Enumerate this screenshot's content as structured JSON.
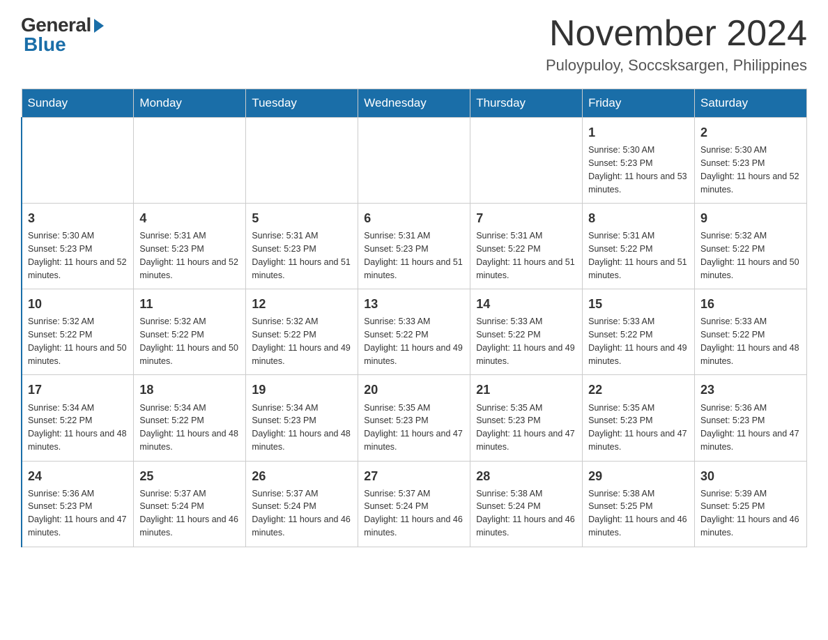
{
  "logo": {
    "general": "General",
    "blue": "Blue"
  },
  "header": {
    "month": "November 2024",
    "location": "Puloypuloy, Soccsksargen, Philippines"
  },
  "weekdays": [
    "Sunday",
    "Monday",
    "Tuesday",
    "Wednesday",
    "Thursday",
    "Friday",
    "Saturday"
  ],
  "weeks": [
    [
      {
        "day": "",
        "sunrise": "",
        "sunset": "",
        "daylight": ""
      },
      {
        "day": "",
        "sunrise": "",
        "sunset": "",
        "daylight": ""
      },
      {
        "day": "",
        "sunrise": "",
        "sunset": "",
        "daylight": ""
      },
      {
        "day": "",
        "sunrise": "",
        "sunset": "",
        "daylight": ""
      },
      {
        "day": "",
        "sunrise": "",
        "sunset": "",
        "daylight": ""
      },
      {
        "day": "1",
        "sunrise": "Sunrise: 5:30 AM",
        "sunset": "Sunset: 5:23 PM",
        "daylight": "Daylight: 11 hours and 53 minutes."
      },
      {
        "day": "2",
        "sunrise": "Sunrise: 5:30 AM",
        "sunset": "Sunset: 5:23 PM",
        "daylight": "Daylight: 11 hours and 52 minutes."
      }
    ],
    [
      {
        "day": "3",
        "sunrise": "Sunrise: 5:30 AM",
        "sunset": "Sunset: 5:23 PM",
        "daylight": "Daylight: 11 hours and 52 minutes."
      },
      {
        "day": "4",
        "sunrise": "Sunrise: 5:31 AM",
        "sunset": "Sunset: 5:23 PM",
        "daylight": "Daylight: 11 hours and 52 minutes."
      },
      {
        "day": "5",
        "sunrise": "Sunrise: 5:31 AM",
        "sunset": "Sunset: 5:23 PM",
        "daylight": "Daylight: 11 hours and 51 minutes."
      },
      {
        "day": "6",
        "sunrise": "Sunrise: 5:31 AM",
        "sunset": "Sunset: 5:23 PM",
        "daylight": "Daylight: 11 hours and 51 minutes."
      },
      {
        "day": "7",
        "sunrise": "Sunrise: 5:31 AM",
        "sunset": "Sunset: 5:22 PM",
        "daylight": "Daylight: 11 hours and 51 minutes."
      },
      {
        "day": "8",
        "sunrise": "Sunrise: 5:31 AM",
        "sunset": "Sunset: 5:22 PM",
        "daylight": "Daylight: 11 hours and 51 minutes."
      },
      {
        "day": "9",
        "sunrise": "Sunrise: 5:32 AM",
        "sunset": "Sunset: 5:22 PM",
        "daylight": "Daylight: 11 hours and 50 minutes."
      }
    ],
    [
      {
        "day": "10",
        "sunrise": "Sunrise: 5:32 AM",
        "sunset": "Sunset: 5:22 PM",
        "daylight": "Daylight: 11 hours and 50 minutes."
      },
      {
        "day": "11",
        "sunrise": "Sunrise: 5:32 AM",
        "sunset": "Sunset: 5:22 PM",
        "daylight": "Daylight: 11 hours and 50 minutes."
      },
      {
        "day": "12",
        "sunrise": "Sunrise: 5:32 AM",
        "sunset": "Sunset: 5:22 PM",
        "daylight": "Daylight: 11 hours and 49 minutes."
      },
      {
        "day": "13",
        "sunrise": "Sunrise: 5:33 AM",
        "sunset": "Sunset: 5:22 PM",
        "daylight": "Daylight: 11 hours and 49 minutes."
      },
      {
        "day": "14",
        "sunrise": "Sunrise: 5:33 AM",
        "sunset": "Sunset: 5:22 PM",
        "daylight": "Daylight: 11 hours and 49 minutes."
      },
      {
        "day": "15",
        "sunrise": "Sunrise: 5:33 AM",
        "sunset": "Sunset: 5:22 PM",
        "daylight": "Daylight: 11 hours and 49 minutes."
      },
      {
        "day": "16",
        "sunrise": "Sunrise: 5:33 AM",
        "sunset": "Sunset: 5:22 PM",
        "daylight": "Daylight: 11 hours and 48 minutes."
      }
    ],
    [
      {
        "day": "17",
        "sunrise": "Sunrise: 5:34 AM",
        "sunset": "Sunset: 5:22 PM",
        "daylight": "Daylight: 11 hours and 48 minutes."
      },
      {
        "day": "18",
        "sunrise": "Sunrise: 5:34 AM",
        "sunset": "Sunset: 5:22 PM",
        "daylight": "Daylight: 11 hours and 48 minutes."
      },
      {
        "day": "19",
        "sunrise": "Sunrise: 5:34 AM",
        "sunset": "Sunset: 5:23 PM",
        "daylight": "Daylight: 11 hours and 48 minutes."
      },
      {
        "day": "20",
        "sunrise": "Sunrise: 5:35 AM",
        "sunset": "Sunset: 5:23 PM",
        "daylight": "Daylight: 11 hours and 47 minutes."
      },
      {
        "day": "21",
        "sunrise": "Sunrise: 5:35 AM",
        "sunset": "Sunset: 5:23 PM",
        "daylight": "Daylight: 11 hours and 47 minutes."
      },
      {
        "day": "22",
        "sunrise": "Sunrise: 5:35 AM",
        "sunset": "Sunset: 5:23 PM",
        "daylight": "Daylight: 11 hours and 47 minutes."
      },
      {
        "day": "23",
        "sunrise": "Sunrise: 5:36 AM",
        "sunset": "Sunset: 5:23 PM",
        "daylight": "Daylight: 11 hours and 47 minutes."
      }
    ],
    [
      {
        "day": "24",
        "sunrise": "Sunrise: 5:36 AM",
        "sunset": "Sunset: 5:23 PM",
        "daylight": "Daylight: 11 hours and 47 minutes."
      },
      {
        "day": "25",
        "sunrise": "Sunrise: 5:37 AM",
        "sunset": "Sunset: 5:24 PM",
        "daylight": "Daylight: 11 hours and 46 minutes."
      },
      {
        "day": "26",
        "sunrise": "Sunrise: 5:37 AM",
        "sunset": "Sunset: 5:24 PM",
        "daylight": "Daylight: 11 hours and 46 minutes."
      },
      {
        "day": "27",
        "sunrise": "Sunrise: 5:37 AM",
        "sunset": "Sunset: 5:24 PM",
        "daylight": "Daylight: 11 hours and 46 minutes."
      },
      {
        "day": "28",
        "sunrise": "Sunrise: 5:38 AM",
        "sunset": "Sunset: 5:24 PM",
        "daylight": "Daylight: 11 hours and 46 minutes."
      },
      {
        "day": "29",
        "sunrise": "Sunrise: 5:38 AM",
        "sunset": "Sunset: 5:25 PM",
        "daylight": "Daylight: 11 hours and 46 minutes."
      },
      {
        "day": "30",
        "sunrise": "Sunrise: 5:39 AM",
        "sunset": "Sunset: 5:25 PM",
        "daylight": "Daylight: 11 hours and 46 minutes."
      }
    ]
  ]
}
